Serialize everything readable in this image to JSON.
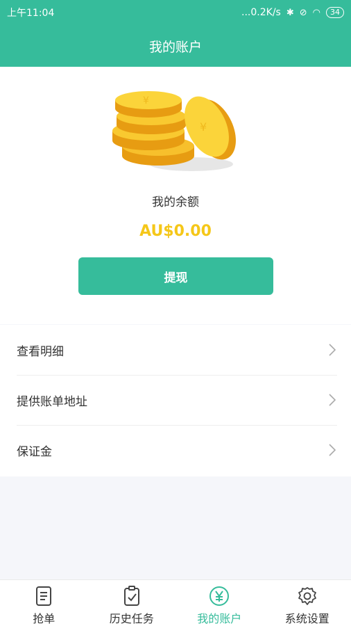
{
  "status_bar": {
    "time": "上午11:04",
    "network_speed": "...0.2K/s",
    "battery": "34"
  },
  "header": {
    "title": "我的账户"
  },
  "balance": {
    "label": "我的余额",
    "amount": "AU$0.00",
    "withdraw_label": "提现"
  },
  "menu": {
    "items": [
      {
        "label": "查看明细",
        "icon": "chevron-right-icon"
      },
      {
        "label": "提供账单地址",
        "icon": "chevron-right-icon"
      },
      {
        "label": "保证金",
        "icon": "chevron-right-icon"
      }
    ]
  },
  "tabbar": {
    "items": [
      {
        "label": "抢单",
        "icon": "document-icon",
        "active": false
      },
      {
        "label": "历史任务",
        "icon": "clipboard-check-icon",
        "active": false
      },
      {
        "label": "我的账户",
        "icon": "yen-circle-icon",
        "active": true
      },
      {
        "label": "系统设置",
        "icon": "gear-icon",
        "active": false
      }
    ]
  },
  "colors": {
    "accent": "#36bc9b",
    "amount": "#f5c719"
  }
}
